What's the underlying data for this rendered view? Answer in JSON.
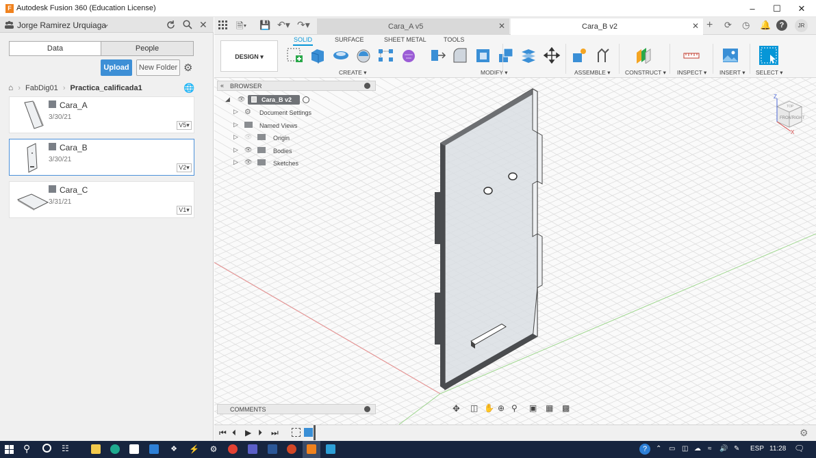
{
  "window": {
    "title": "Autodesk Fusion 360 (Education License)",
    "app_icon_letter": "F"
  },
  "datapanel": {
    "user": "Jorge Ramirez Urquiaga",
    "tabs": [
      "Data",
      "People"
    ],
    "upload_label": "Upload",
    "new_folder_label": "New Folder",
    "breadcrumb": [
      "FabDig01",
      "Practica_calificada1"
    ],
    "files": [
      {
        "name": "Cara_A",
        "date": "3/30/21",
        "version": "V5"
      },
      {
        "name": "Cara_B",
        "date": "3/30/21",
        "version": "V2"
      },
      {
        "name": "Cara_C",
        "date": "3/31/21",
        "version": "V1"
      }
    ]
  },
  "doc_tabs": [
    {
      "label": "Cara_A v5",
      "active": false
    },
    {
      "label": "Cara_B v2",
      "active": true
    }
  ],
  "user_initials": "JR",
  "toolbar": {
    "design_label": "DESIGN",
    "tabs": [
      "SOLID",
      "SURFACE",
      "SHEET METAL",
      "TOOLS"
    ],
    "active_tab": "SOLID",
    "groups": [
      "CREATE",
      "MODIFY",
      "ASSEMBLE",
      "CONSTRUCT",
      "INSPECT",
      "INSERT",
      "SELECT"
    ]
  },
  "browser": {
    "title": "BROWSER",
    "root": "Cara_B v2",
    "items": [
      "Document Settings",
      "Named Views",
      "Origin",
      "Bodies",
      "Sketches"
    ]
  },
  "comments_label": "COMMENTS",
  "viewcube": {
    "faces": [
      "TOP",
      "FRONT",
      "RIGHT"
    ],
    "axes": [
      "Z",
      "X"
    ]
  },
  "taskbar": {
    "lang": "ESP",
    "time": "11:28"
  },
  "colors": {
    "accent": "#0696d7",
    "upload": "#3d8fd6",
    "taskbar": "#17253f"
  }
}
